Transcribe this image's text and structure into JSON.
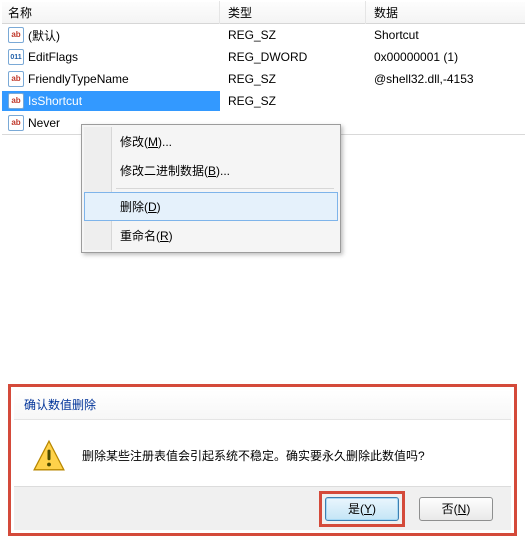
{
  "columns": {
    "name": "名称",
    "type": "类型",
    "data": "数据"
  },
  "rows": [
    {
      "icon": "sz",
      "name": "(默认)",
      "type": "REG_SZ",
      "data": "Shortcut"
    },
    {
      "icon": "bin",
      "name": "EditFlags",
      "type": "REG_DWORD",
      "data": "0x00000001 (1)"
    },
    {
      "icon": "sz",
      "name": "FriendlyTypeName",
      "type": "REG_SZ",
      "data": "@shell32.dll,-4153"
    },
    {
      "icon": "sz",
      "name": "IsShortcut",
      "type": "REG_SZ",
      "data": "",
      "selected": true
    },
    {
      "icon": "sz",
      "name": "Never",
      "type": "",
      "data": ""
    }
  ],
  "context_menu": {
    "modify": {
      "pre": "修改(",
      "ul": "M",
      "post": ")..."
    },
    "modify_bin": {
      "pre": "修改二进制数据(",
      "ul": "B",
      "post": ")..."
    },
    "delete": {
      "pre": "删除(",
      "ul": "D",
      "post": ")"
    },
    "rename": {
      "pre": "重命名(",
      "ul": "R",
      "post": ")"
    }
  },
  "dialog": {
    "title": "确认数值删除",
    "message": "删除某些注册表值会引起系统不稳定。确实要永久删除此数值吗?",
    "yes": {
      "pre": "是(",
      "ul": "Y",
      "post": ")"
    },
    "no": {
      "pre": "否(",
      "ul": "N",
      "post": ")"
    }
  }
}
